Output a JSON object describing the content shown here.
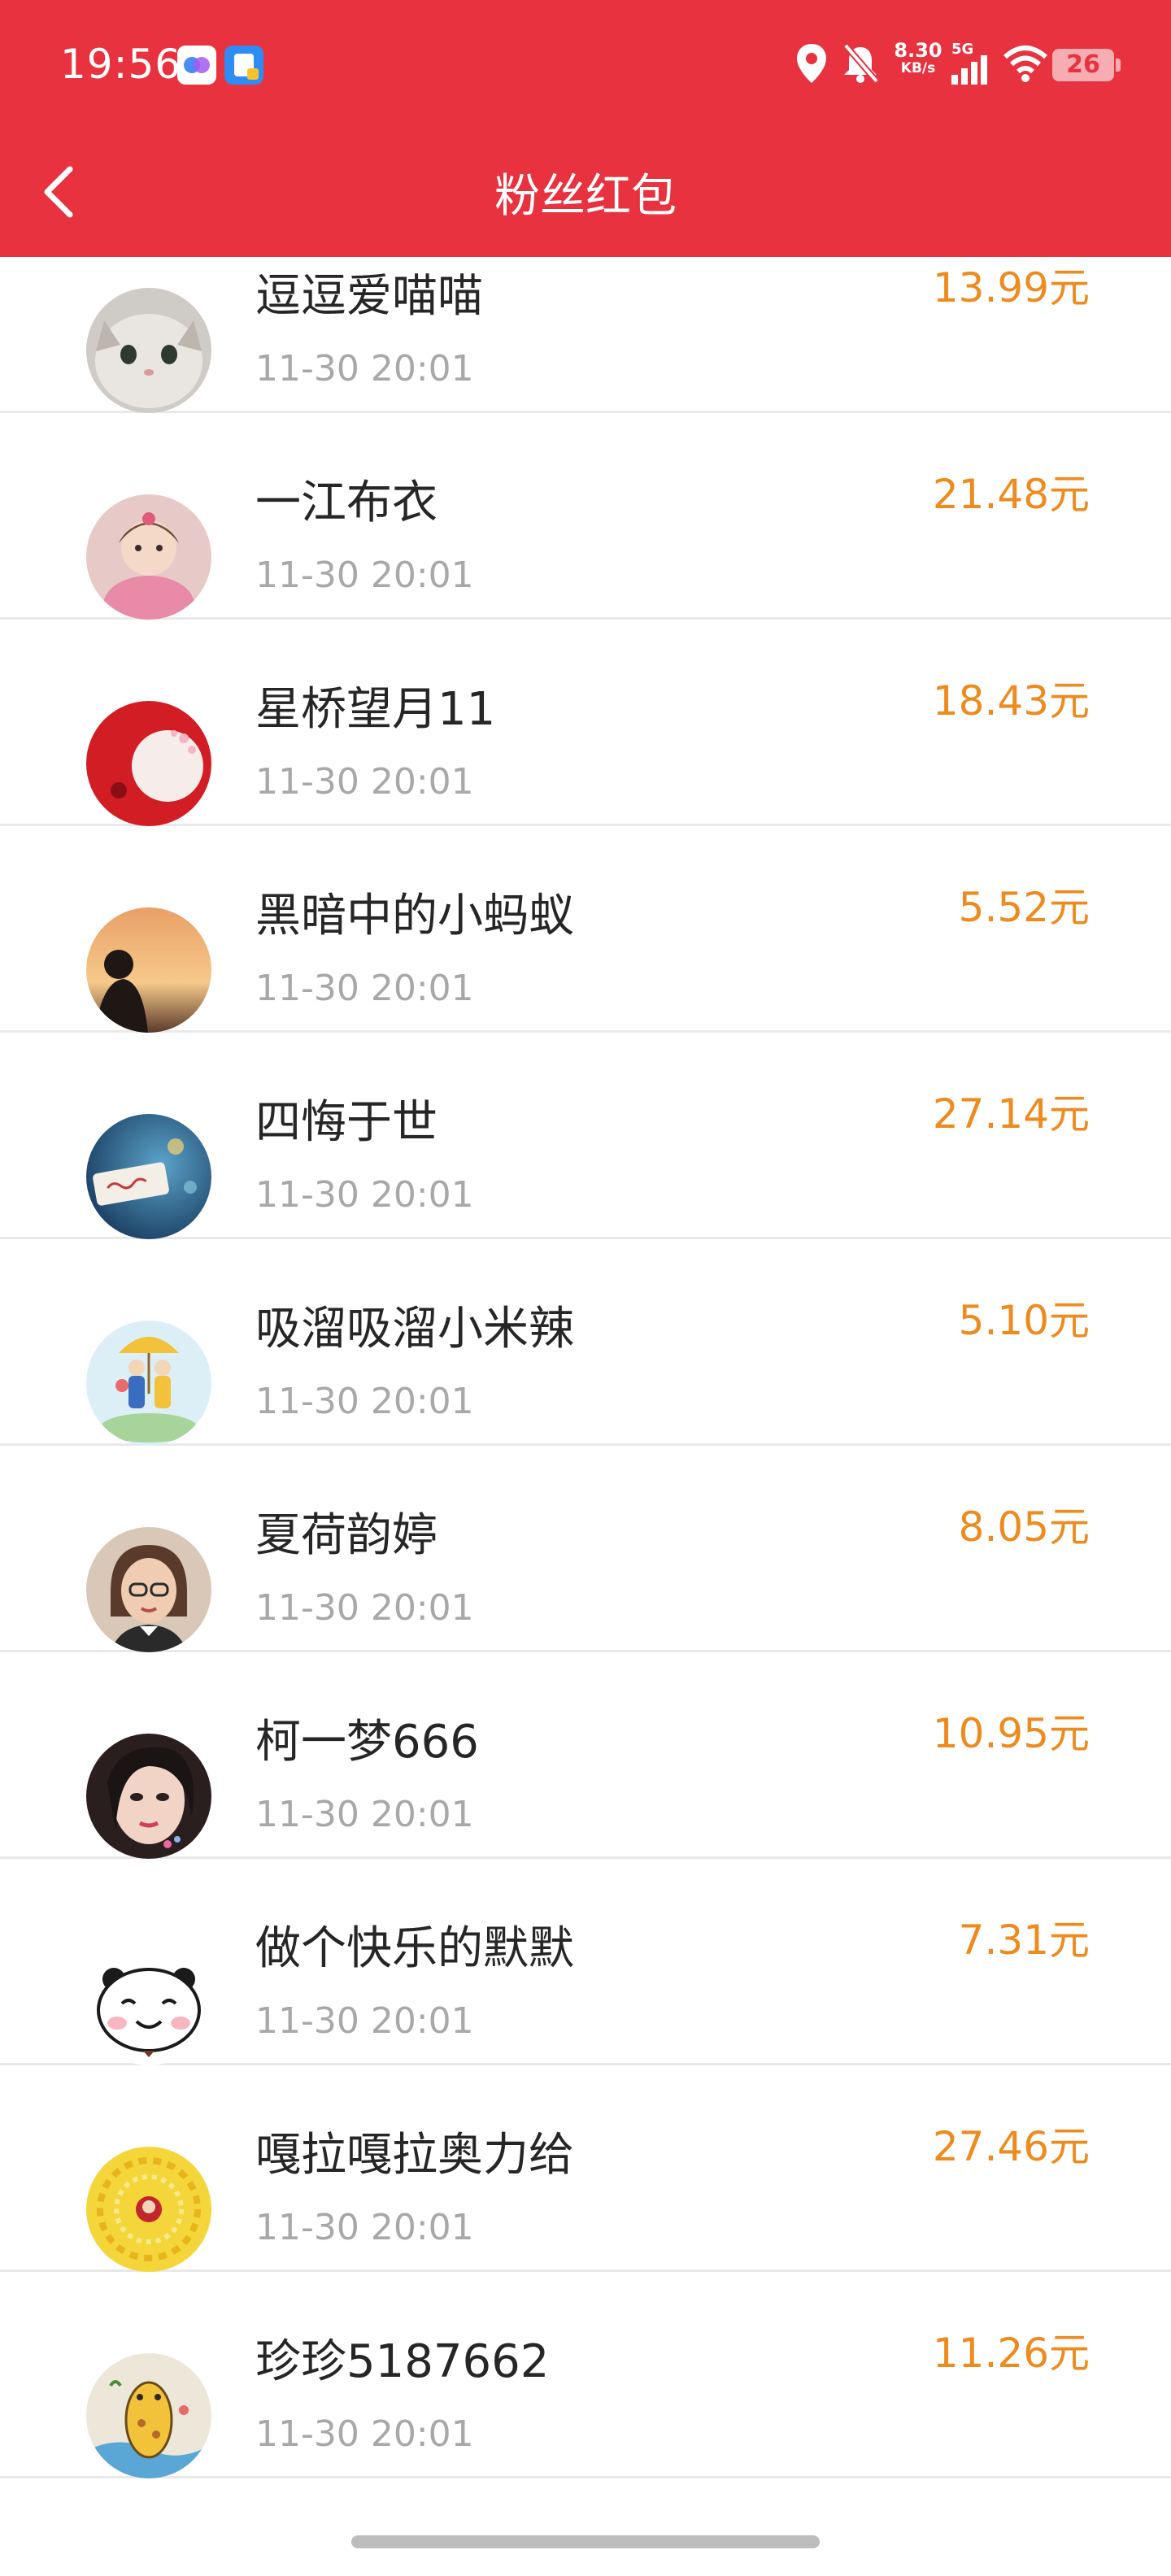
{
  "status_bar": {
    "time": "19:56",
    "net_speed": "8.30",
    "net_speed_unit": "KB/s",
    "network": "5G",
    "battery": "26",
    "icons": [
      "app-icon-1",
      "app-icon-2",
      "location-icon",
      "bell-mute-icon",
      "signal-icon",
      "wifi-icon",
      "battery-icon"
    ]
  },
  "header": {
    "title": "粉丝红包",
    "back_icon": "chevron-left-icon",
    "background": "#E8323F"
  },
  "colors": {
    "amount": "#EE8B1E",
    "date": "#A8A8A8",
    "name": "#262626"
  },
  "list": {
    "items": [
      {
        "name": "逗逗爱喵喵",
        "date": "11-30 20:01",
        "amount": "13.99元"
      },
      {
        "name": "一江布衣",
        "date": "11-30 20:01",
        "amount": "21.48元"
      },
      {
        "name": "星桥望月11",
        "date": "11-30 20:01",
        "amount": "18.43元"
      },
      {
        "name": "黑暗中的小蚂蚁",
        "date": "11-30 20:01",
        "amount": "5.52元"
      },
      {
        "name": "四悔于世",
        "date": "11-30 20:01",
        "amount": "27.14元"
      },
      {
        "name": "吸溜吸溜小米辣",
        "date": "11-30 20:01",
        "amount": "5.10元"
      },
      {
        "name": "夏荷韵婷",
        "date": "11-30 20:01",
        "amount": "8.05元"
      },
      {
        "name": "柯一梦666",
        "date": "11-30 20:01",
        "amount": "10.95元"
      },
      {
        "name": "做个快乐的默默",
        "date": "11-30 20:01",
        "amount": "7.31元"
      },
      {
        "name": "嘎拉嘎拉奥力给",
        "date": "11-30 20:01",
        "amount": "27.46元"
      },
      {
        "name": "珍珍5187662",
        "date": "11-30 20:01",
        "amount": "11.26元"
      }
    ]
  }
}
